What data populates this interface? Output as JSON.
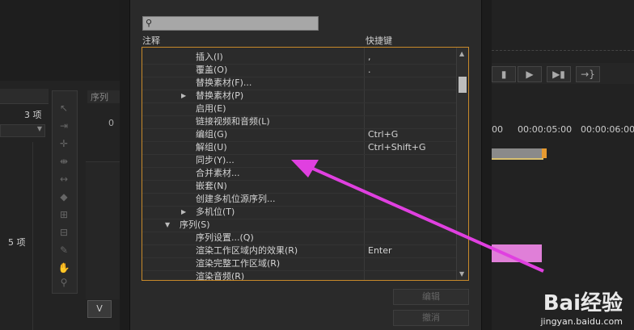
{
  "background": {
    "project_count_top": "3 项",
    "project_count_bottom": "5 项",
    "sequence_tab": "序列",
    "timecode_1": "00:00:05:00",
    "timecode_2": "00:00:06:00",
    "timecode_prefix": "00",
    "zero_label": "0",
    "v_label": "V"
  },
  "dialog": {
    "search_placeholder": "",
    "col_command": "注释",
    "col_shortcut": "快捷键",
    "rows": [
      {
        "label": "插入(I)",
        "shortcut": ",",
        "indent": 2,
        "arrow": ""
      },
      {
        "label": "覆盖(O)",
        "shortcut": ".",
        "indent": 2,
        "arrow": ""
      },
      {
        "label": "替换素材(F)...",
        "shortcut": "",
        "indent": 2,
        "arrow": ""
      },
      {
        "label": "替换素材(P)",
        "shortcut": "",
        "indent": 2,
        "arrow": "▶"
      },
      {
        "label": "启用(E)",
        "shortcut": "",
        "indent": 2,
        "arrow": ""
      },
      {
        "label": "链接视频和音频(L)",
        "shortcut": "",
        "indent": 2,
        "arrow": ""
      },
      {
        "label": "编组(G)",
        "shortcut": "Ctrl+G",
        "indent": 2,
        "arrow": ""
      },
      {
        "label": "解组(U)",
        "shortcut": "Ctrl+Shift+G",
        "indent": 2,
        "arrow": ""
      },
      {
        "label": "同步(Y)...",
        "shortcut": "",
        "indent": 2,
        "arrow": ""
      },
      {
        "label": "合并素材...",
        "shortcut": "",
        "indent": 2,
        "arrow": ""
      },
      {
        "label": "嵌套(N)",
        "shortcut": "",
        "indent": 2,
        "arrow": ""
      },
      {
        "label": "创建多机位源序列...",
        "shortcut": "",
        "indent": 2,
        "arrow": ""
      },
      {
        "label": "多机位(T)",
        "shortcut": "",
        "indent": 2,
        "arrow": "▶"
      },
      {
        "label": "序列(S)",
        "shortcut": "",
        "indent": 1,
        "arrow": "▼"
      },
      {
        "label": "序列设置...(Q)",
        "shortcut": "",
        "indent": 2,
        "arrow": ""
      },
      {
        "label": "渲染工作区域内的效果(R)",
        "shortcut": "Enter",
        "indent": 2,
        "arrow": ""
      },
      {
        "label": "渲染完整工作区域(R)",
        "shortcut": "",
        "indent": 2,
        "arrow": ""
      },
      {
        "label": "渲染音频(R)",
        "shortcut": "",
        "indent": 2,
        "arrow": ""
      }
    ],
    "edit_button": "编辑",
    "undo_button": "撤消"
  },
  "watermark": {
    "logo": "Bai经验",
    "url": "jingyan.baidu.com"
  },
  "colors": {
    "accent_border": "#c88a2a",
    "annotation_arrow": "#e040e0"
  }
}
